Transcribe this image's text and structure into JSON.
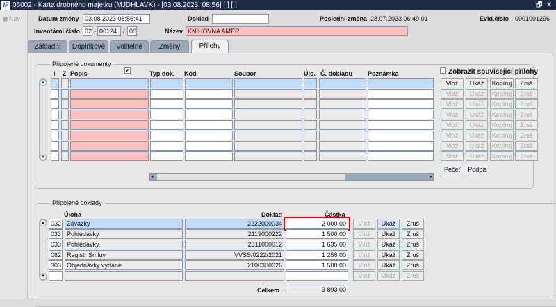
{
  "window": {
    "title": "05002 - Karta drobného majetku (MJDHLAVK) - [03.08.2023; 08:56]  [ ]  [ ]",
    "logo": "IF",
    "restore": "🗗",
    "close": "✕"
  },
  "nav": {
    "label": "Nav"
  },
  "header": {
    "datum_zmeny_label": "Datum změny",
    "datum_zmeny": "03.08.2023 08:56:41",
    "doklad_label": "Doklad",
    "doklad": "",
    "posledni_zmena_label": "Poslední změna",
    "posledni_zmena": "28.07.2023 06:49:01",
    "evid_label": "Evid.číslo",
    "evid": "0001001296",
    "inv_label": "Inventární číslo",
    "inv1": "02",
    "inv_sep1": "-",
    "inv2": "06124",
    "inv_sep2": "/",
    "inv3": "00",
    "nazev_label": "Název",
    "nazev": "KNIHOVNA AMER."
  },
  "tabs": [
    {
      "label": "Základní"
    },
    {
      "label": "Doplňkové"
    },
    {
      "label": "Volitelné"
    },
    {
      "label": "Změny"
    },
    {
      "label": "Přílohy",
      "active": true
    }
  ],
  "documents": {
    "title": "Připojené dokumenty",
    "columns": {
      "i": "i",
      "z": "Z",
      "popis": "Popis",
      "typ": "Typ dok.",
      "kod": "Kód",
      "soubor": "Soubor",
      "ulo": "Úlo.",
      "cdokladu": "Č. dokladu",
      "poznamka": "Poznámka"
    },
    "show_related_label": "Zobrazit související přílohy",
    "row_count": 8,
    "buttons": {
      "insert": "Vlož",
      "show": "Ukáž",
      "copy": "Kopíruj",
      "delete": "Zruš"
    },
    "stamp": "Pečeť",
    "sign": "Podpis"
  },
  "linked": {
    "title": "Připojené doklady",
    "columns": {
      "uloha": "Úloha",
      "doklad": "Doklad",
      "castka": "Částka"
    },
    "rows": [
      {
        "code": "032",
        "name": "Závazky",
        "doklad": "2222000034",
        "castka": "-2 000.00"
      },
      {
        "code": "033",
        "name": "Pohledávky",
        "doklad": "2119000222",
        "castka": "1 500.00"
      },
      {
        "code": "033",
        "name": "Pohledávky",
        "doklad": "2311000012",
        "castka": "1 635.00"
      },
      {
        "code": "082",
        "name": "Registr Smluv",
        "doklad": "VVSS/0222/2021",
        "castka": "1 258.00"
      },
      {
        "code": "303",
        "name": "Objednávky vydané",
        "doklad": "2100300026",
        "castka": "1 500.00"
      },
      {
        "code": "",
        "name": "",
        "doklad": "",
        "castka": ""
      }
    ],
    "buttons": {
      "insert": "Vlož",
      "show": "Ukáž",
      "delete": "Zruš"
    },
    "total_label": "Celkem",
    "total": "3 893.00"
  }
}
